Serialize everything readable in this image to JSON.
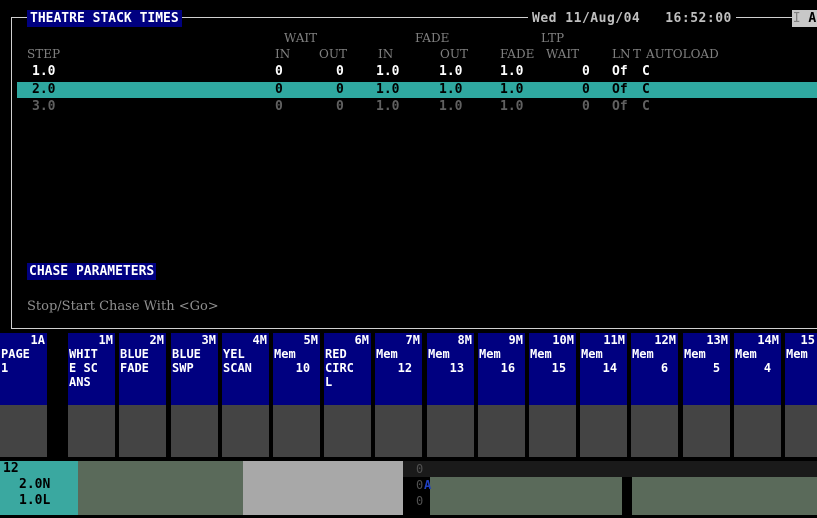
{
  "header": {
    "title": "THEATRE STACK TIMES",
    "date": "Wed 11/Aug/04",
    "time": "16:52:00",
    "mode_dim": "I",
    "mode": "A"
  },
  "columns": {
    "group_wait": "WAIT",
    "group_fade": "FADE",
    "group_ltp": "LTP",
    "step": "STEP",
    "wait_in": "IN",
    "wait_out": "OUT",
    "fade_in": "IN",
    "fade_out": "OUT",
    "ltp_fade": "FADE",
    "ltp_wait": "WAIT",
    "ln": "LN",
    "t": "T",
    "autoload": "AUTOLOAD"
  },
  "steps": [
    {
      "step": "1.0",
      "wait_in": "0",
      "wait_out": "0",
      "fade_in": "1.0",
      "fade_out": "1.0",
      "ltp_fade": "1.0",
      "ltp_wait": "0",
      "ln": "Of",
      "t": "C"
    },
    {
      "step": "2.0",
      "wait_in": "0",
      "wait_out": "0",
      "fade_in": "1.0",
      "fade_out": "1.0",
      "ltp_fade": "1.0",
      "ltp_wait": "0",
      "ln": "Of",
      "t": "C"
    },
    {
      "step": "3.0",
      "wait_in": "0",
      "wait_out": "0",
      "fade_in": "1.0",
      "fade_out": "1.0",
      "ltp_fade": "1.0",
      "ltp_wait": "0",
      "ln": "Of",
      "t": "C"
    }
  ],
  "chase": {
    "title": "CHASE PARAMETERS",
    "hint": "Stop/Start Chase With <Go>"
  },
  "submasters": [
    {
      "num": "1A",
      "label": "PAGE\n1"
    },
    {
      "num": "1M",
      "label": "WHIT\nE SC\nANS"
    },
    {
      "num": "2M",
      "label": "BLUE\nFADE"
    },
    {
      "num": "3M",
      "label": "BLUE\nSWP"
    },
    {
      "num": "4M",
      "label": "YEL\nSCAN"
    },
    {
      "num": "5M",
      "label": "Mem\n   10"
    },
    {
      "num": "6M",
      "label": "RED\nCIRC\nL"
    },
    {
      "num": "7M",
      "label": "Mem\n   12"
    },
    {
      "num": "8M",
      "label": "Mem\n   13"
    },
    {
      "num": "9M",
      "label": "Mem\n   16"
    },
    {
      "num": "10M",
      "label": "Mem\n   15"
    },
    {
      "num": "11M",
      "label": "Mem\n   14"
    },
    {
      "num": "12M",
      "label": "Mem\n    6"
    },
    {
      "num": "13M",
      "label": "Mem\n    5"
    },
    {
      "num": "14M",
      "label": "Mem\n    4"
    },
    {
      "num": "15",
      "label": "Mem"
    }
  ],
  "status": {
    "step": "12",
    "fade": "2.0N",
    "wait": "1.0L",
    "zero1": "0",
    "zero2": "0",
    "zero3": "0",
    "a_label": "A"
  }
}
